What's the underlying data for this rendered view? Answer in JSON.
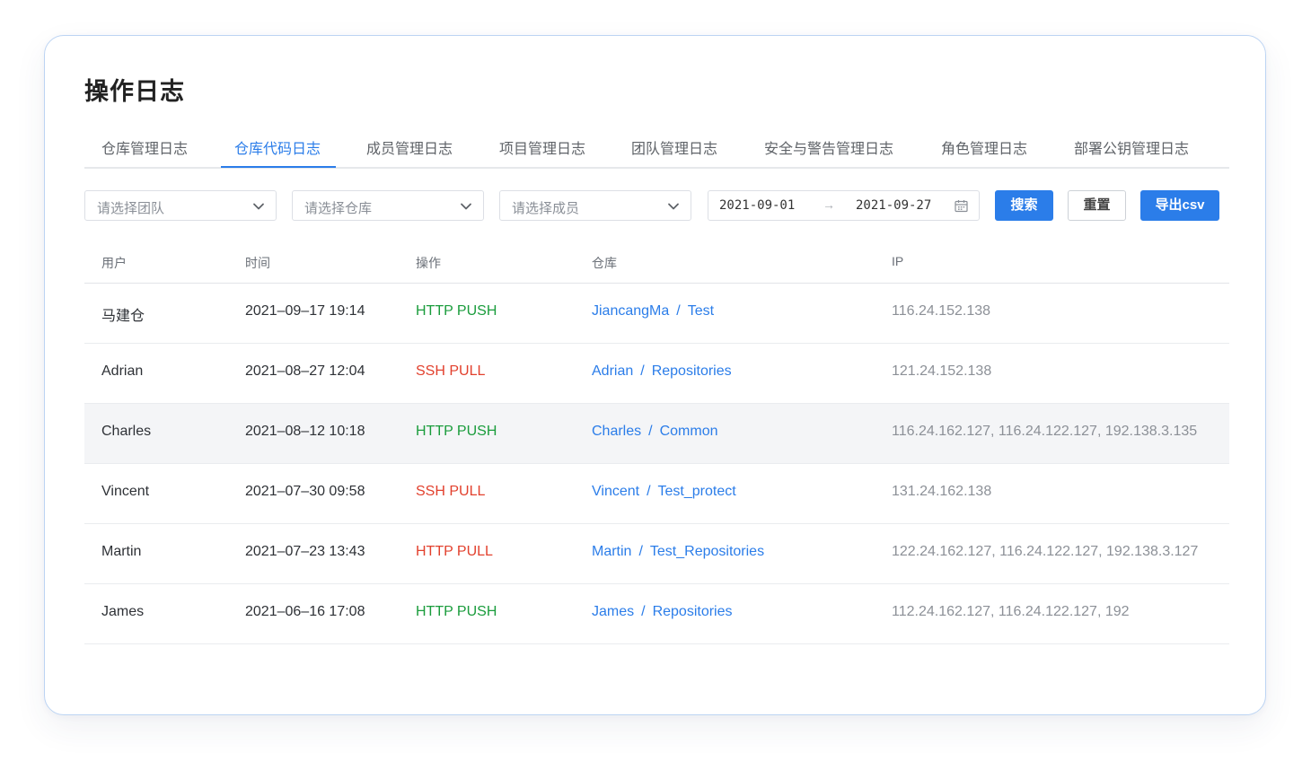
{
  "page": {
    "title": "操作日志"
  },
  "tabs": [
    {
      "label": "仓库管理日志",
      "active": false
    },
    {
      "label": "仓库代码日志",
      "active": true
    },
    {
      "label": "成员管理日志",
      "active": false
    },
    {
      "label": "项目管理日志",
      "active": false
    },
    {
      "label": "团队管理日志",
      "active": false
    },
    {
      "label": "安全与警告管理日志",
      "active": false
    },
    {
      "label": "角色管理日志",
      "active": false
    },
    {
      "label": "部署公钥管理日志",
      "active": false
    }
  ],
  "filters": {
    "team_placeholder": "请选择团队",
    "repo_placeholder": "请选择仓库",
    "member_placeholder": "请选择成员",
    "date_start": "2021-09-01",
    "date_arrow": "→",
    "date_end": "2021-09-27",
    "search_label": "搜索",
    "reset_label": "重置",
    "export_label": "导出csv"
  },
  "table": {
    "columns": {
      "user": "用户",
      "time": "时间",
      "operation": "操作",
      "repo": "仓库",
      "ip": "IP"
    },
    "rows": [
      {
        "user": "马建仓",
        "time": "2021–09–17 19:14",
        "operation": "HTTP PUSH",
        "op_color": "green",
        "owner": "JiancangMa",
        "repo_sep": "/",
        "repo": "Test",
        "ip": "116.24.152.138"
      },
      {
        "user": "Adrian",
        "time": "2021–08–27 12:04",
        "operation": "SSH PULL",
        "op_color": "red",
        "owner": "Adrian",
        "repo_sep": "/",
        "repo": "Repositories",
        "ip": "121.24.152.138"
      },
      {
        "user": "Charles",
        "time": "2021–08–12 10:18",
        "operation": "HTTP PUSH",
        "op_color": "green",
        "owner": "Charles",
        "repo_sep": "/",
        "repo": "Common",
        "ip": "116.24.162.127, 116.24.122.127, 192.138.3.135"
      },
      {
        "user": "Vincent",
        "time": "2021–07–30 09:58",
        "operation": "SSH PULL",
        "op_color": "red",
        "owner": "Vincent",
        "repo_sep": "/",
        "repo": "Test_protect",
        "ip": "131.24.162.138"
      },
      {
        "user": "Martin",
        "time": "2021–07–23 13:43",
        "operation": "HTTP PULL",
        "op_color": "red",
        "owner": "Martin",
        "repo_sep": "/",
        "repo": "Test_Repositories",
        "ip": "122.24.162.127, 116.24.122.127, 192.138.3.127"
      },
      {
        "user": "James",
        "time": "2021–06–16 17:08",
        "operation": "HTTP PUSH",
        "op_color": "green",
        "owner": "James",
        "repo_sep": "/",
        "repo": "Repositories",
        "ip": "112.24.162.127, 116.24.122.127, 192"
      }
    ]
  },
  "colors": {
    "accent": "#2b7de9",
    "push_green": "#1a9c3c",
    "pull_red": "#e2412e",
    "ip_gray": "#8c9097",
    "hover_row": "#f4f5f7"
  },
  "icons": {
    "select": "chevron-down-icon",
    "date": "calendar-icon"
  }
}
